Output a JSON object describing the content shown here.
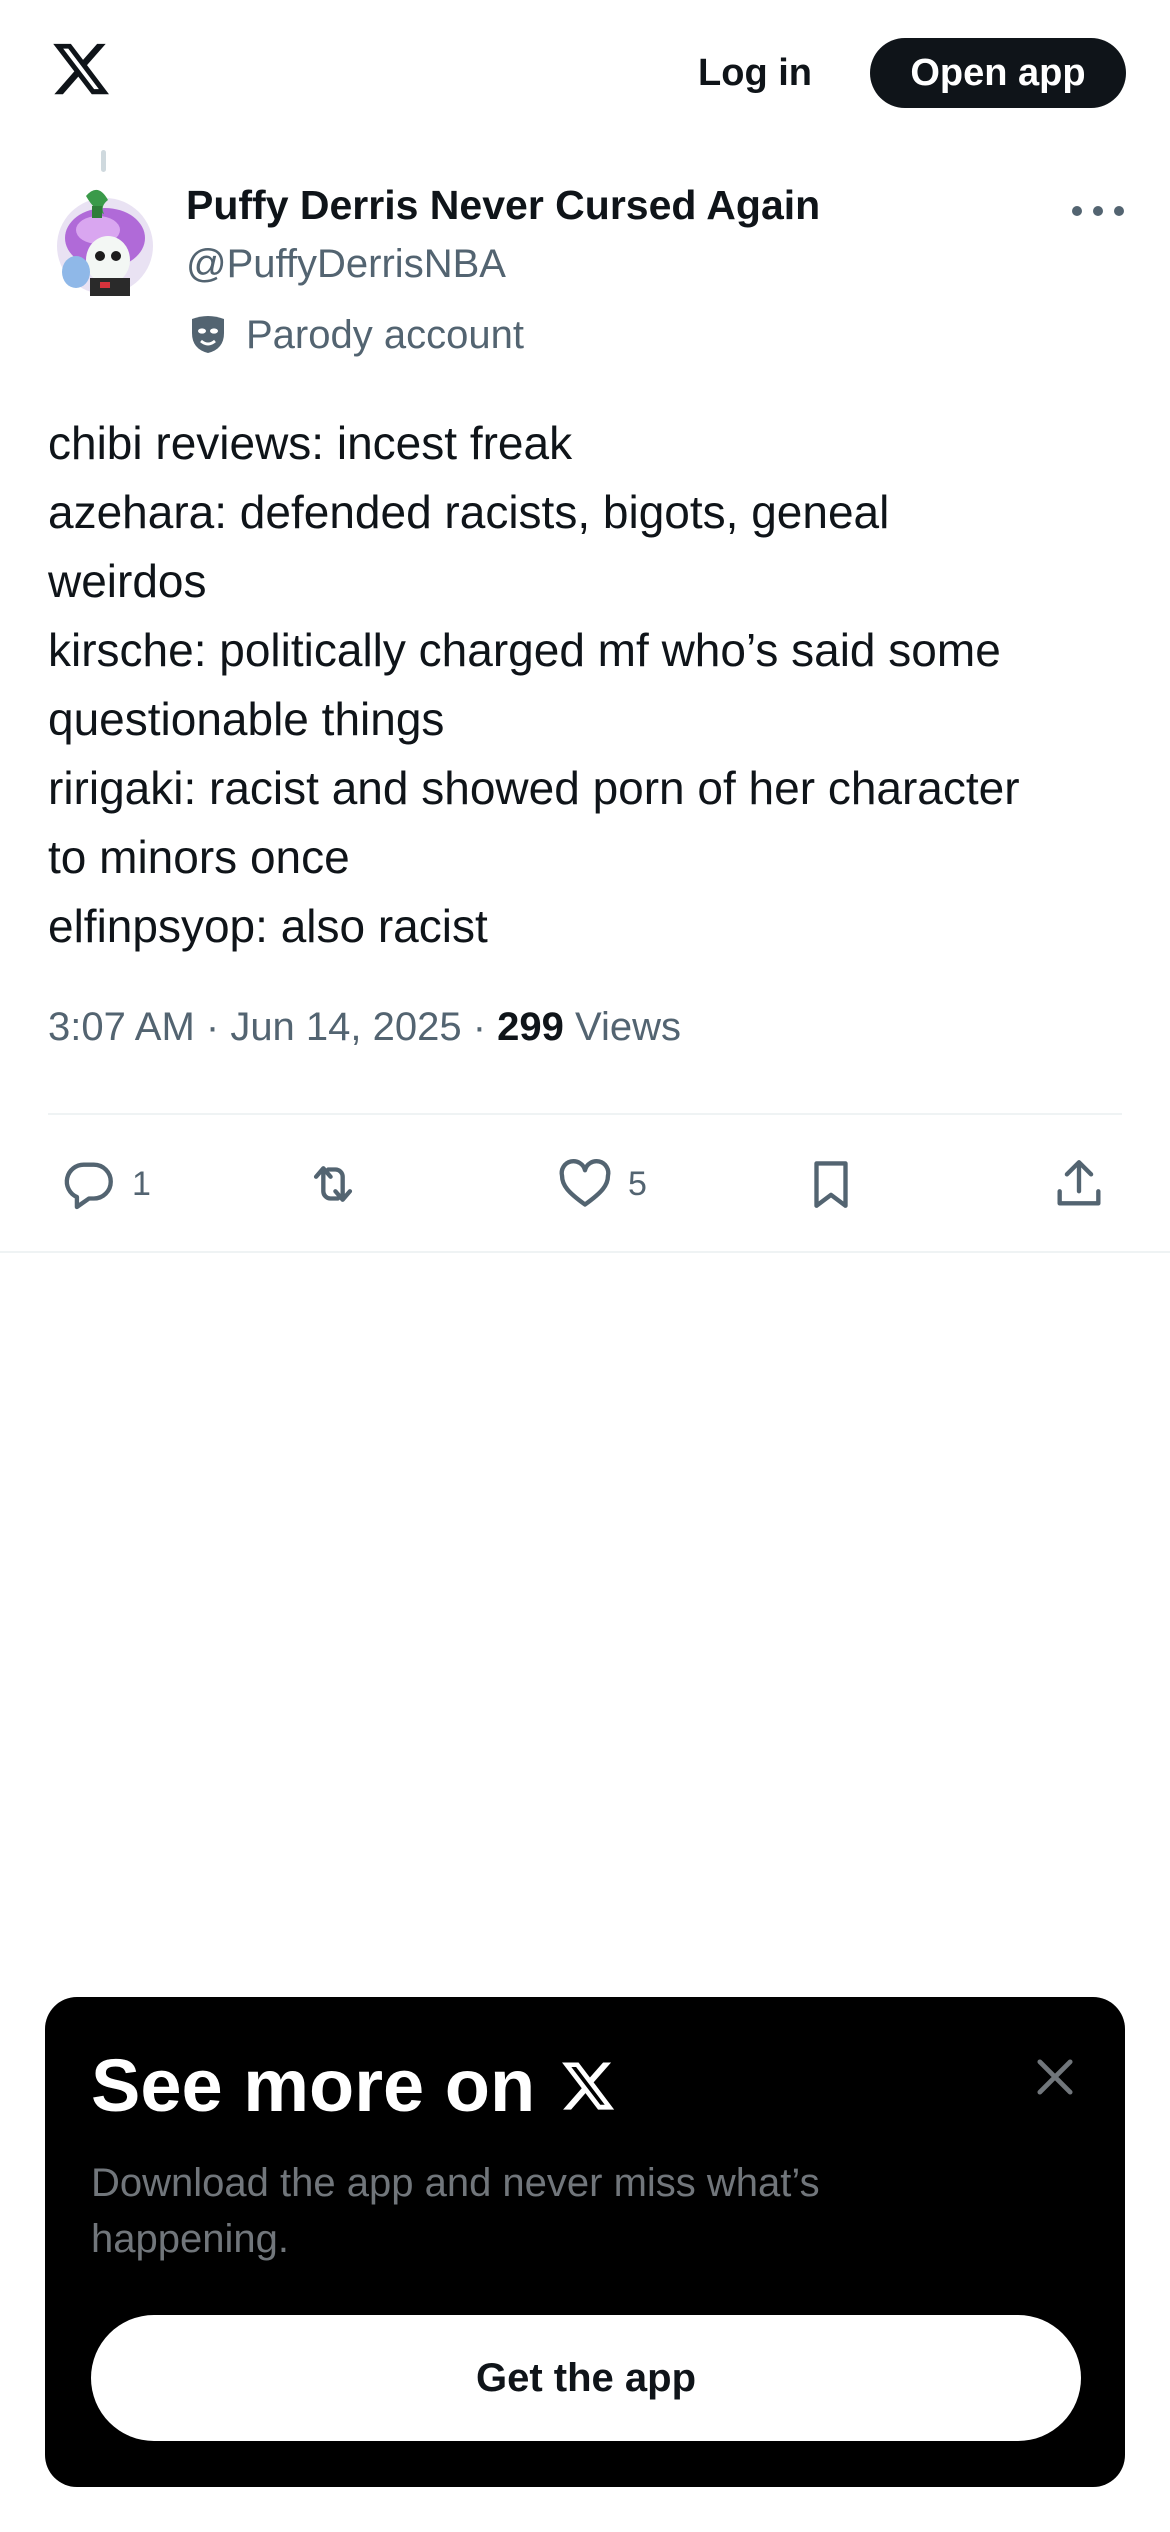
{
  "header": {
    "logo_icon": "x-logo-icon",
    "login_label": "Log in",
    "open_app_label": "Open app"
  },
  "author": {
    "display_name": "Puffy Derris Never Cursed Again",
    "handle": "@PuffyDerrisNBA",
    "badge_icon": "parody-mask-icon",
    "badge_label": "Parody account",
    "more_icon": "more-options-icon"
  },
  "tweet": {
    "lines": [
      "chibi reviews: incest freak",
      "azehara: defended racists, bigots, geneal",
      "weirdos",
      "kirsche: politically charged mf who’s said some",
      "questionable things",
      "ririgaki: racist and showed porn of her character",
      "to minors once",
      "elfinpsyop: also racist"
    ],
    "time": "3:07 AM",
    "date": "Jun 14, 2025",
    "separator": " · ",
    "views_count": "299",
    "views_label": "Views"
  },
  "actions": {
    "reply_count": "1",
    "retweet_count": "",
    "like_count": "5",
    "icons": [
      "reply-icon",
      "retweet-icon",
      "like-icon",
      "bookmark-icon",
      "share-icon"
    ]
  },
  "promo": {
    "title": "See more on",
    "description": "Download the app and never miss what’s happening.",
    "button_label": "Get the app",
    "close_icon": "close-icon"
  },
  "colors": {
    "text_primary": "#0f1419",
    "text_secondary": "#536471",
    "promo_background": "#000000",
    "promo_text_muted": "#71767b"
  }
}
